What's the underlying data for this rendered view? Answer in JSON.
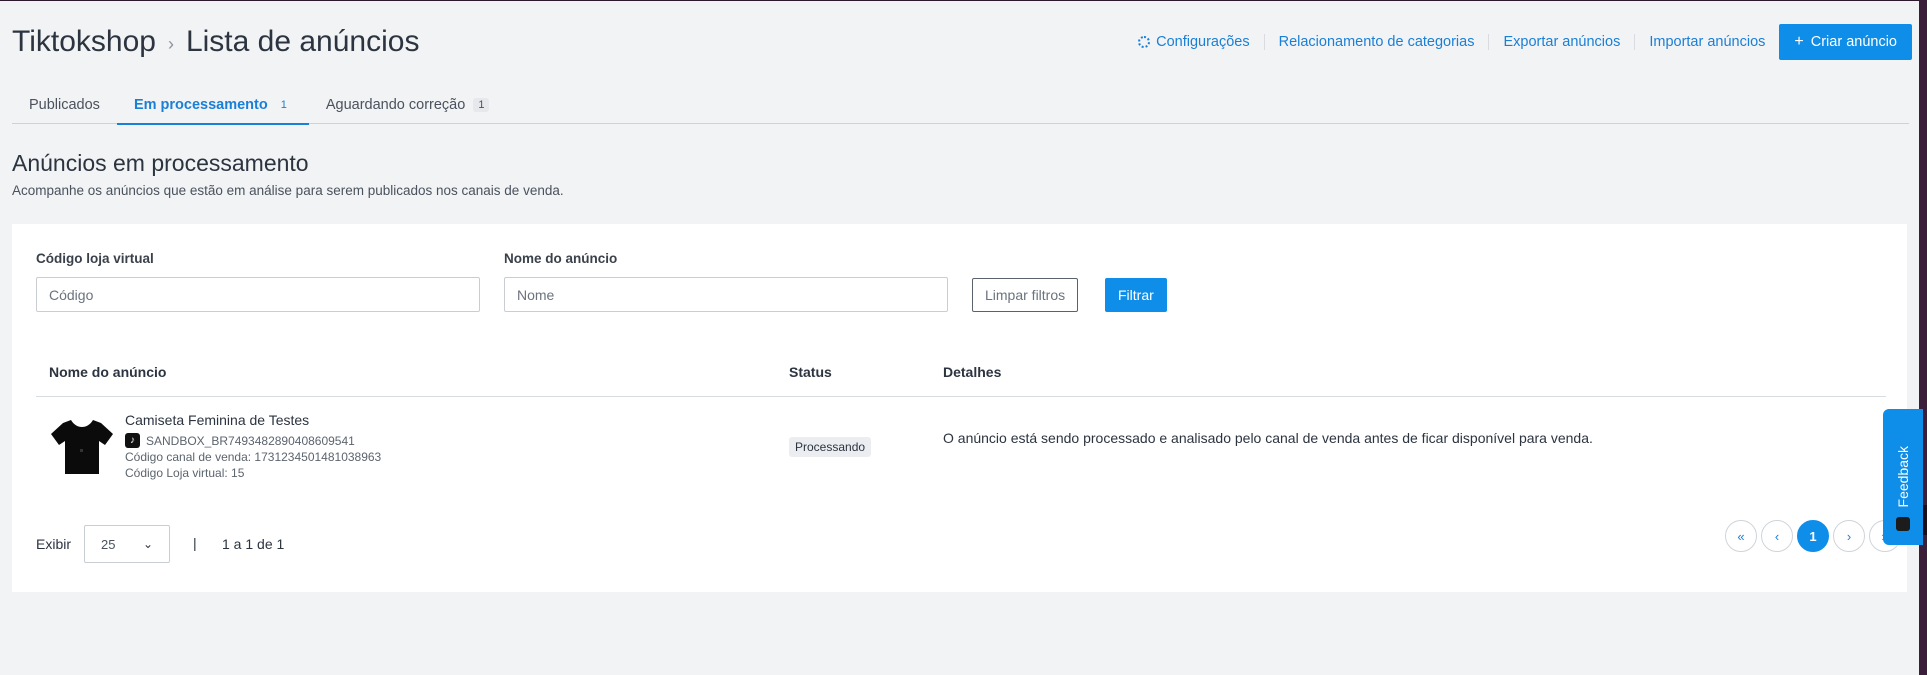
{
  "header": {
    "breadcrumb_root": "Tiktokshop",
    "breadcrumb_sep": "›",
    "page_title": "Lista de anúncios",
    "actions": {
      "settings": "Configurações",
      "categories": "Relacionamento de categorias",
      "export": "Exportar anúncios",
      "import": "Importar anúncios",
      "create": "Criar anúncio",
      "create_icon": "+"
    }
  },
  "tabs": [
    {
      "label": "Publicados",
      "count": ""
    },
    {
      "label": "Em processamento",
      "count": "1"
    },
    {
      "label": "Aguardando correção",
      "count": "1"
    }
  ],
  "section": {
    "title": "Anúncios em processamento",
    "subtitle": "Acompanhe os anúncios que estão em análise para serem publicados nos canais de venda."
  },
  "filters": {
    "store_code_label": "Código loja virtual",
    "store_code_placeholder": "Código",
    "name_label": "Nome do anúncio",
    "name_placeholder": "Nome",
    "clear_label": "Limpar filtros",
    "filter_label": "Filtrar"
  },
  "table": {
    "columns": [
      "Nome do anúncio",
      "Status",
      "Detalhes"
    ],
    "rows": [
      {
        "name": "Camiseta Feminina de Testes",
        "sku": "SANDBOX_BR7493482890408609541",
        "channel_code": "Código canal de venda: 1731234501481038963",
        "store_code": "Código Loja virtual: 15",
        "status": "Processando",
        "details": "O anúncio está sendo processado e analisado pelo canal de venda antes de ficar disponível para venda."
      }
    ]
  },
  "pagination": {
    "show_label": "Exibir",
    "page_size": "25",
    "pipe": "|",
    "range": "1 a 1 de 1",
    "first": "«",
    "prev": "‹",
    "current": "1",
    "next": "›",
    "last": "»"
  },
  "feedback": {
    "label": "Feedback"
  },
  "colors": {
    "accent": "#0e8ee9",
    "link": "#1a7fd6"
  }
}
